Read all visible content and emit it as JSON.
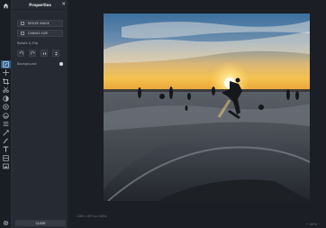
{
  "toolbar": {
    "home_icon": "home-icon",
    "settings_icon": "gear-icon",
    "tools": [
      {
        "name": "resize-tool",
        "icon": "resize-icon",
        "active": true
      },
      {
        "name": "move-tool",
        "icon": "move-icon",
        "active": false
      },
      {
        "name": "crop-tool",
        "icon": "crop-icon",
        "active": false
      },
      {
        "name": "cut-tool",
        "icon": "scissors-icon",
        "active": false
      },
      {
        "name": "filter-tool",
        "icon": "filter-icon",
        "active": false
      },
      {
        "name": "adjust-tool",
        "icon": "adjust-icon",
        "active": false
      },
      {
        "name": "effects-tool",
        "icon": "effects-icon",
        "active": false
      },
      {
        "name": "frames-tool",
        "icon": "frames-icon",
        "active": false
      },
      {
        "name": "transform-tool",
        "icon": "transform-icon",
        "active": false
      },
      {
        "name": "draw-tool",
        "icon": "brush-icon",
        "active": false
      },
      {
        "name": "text-tool",
        "icon": "text-icon",
        "active": false
      },
      {
        "name": "shapes-tool",
        "icon": "shapes-icon",
        "active": false
      },
      {
        "name": "image-tool",
        "icon": "image-icon",
        "active": false
      }
    ]
  },
  "panel": {
    "title": "Properties",
    "close_glyph": "✕",
    "resize_image_label": "RESIZE IMAGE",
    "canvas_size_label": "CANVAS SIZE",
    "rotate_flip_label": "Rotate & Flip",
    "background_label": "Background",
    "close_button_label": "CLOSE"
  },
  "status": {
    "left_text": "1280 x 853 px  100%",
    "right_text": "+  100%  −"
  },
  "colors": {
    "accent": "#2f5f8a",
    "panel_bg": "#262a32",
    "canvas_bg": "#1b1e24"
  }
}
